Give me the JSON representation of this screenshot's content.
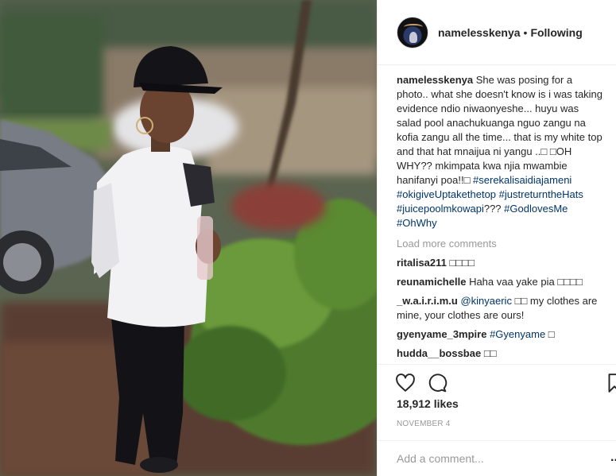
{
  "post": {
    "photo_alt": "Photo by namelesskenya"
  },
  "header": {
    "username": "namelesskenya",
    "separator": "•",
    "follow_status": "Following"
  },
  "caption": {
    "username": "namelesskenya",
    "text": "She was posing for a photo.. what she doesn't know is i was taking evidence ndio niwaonyeshe... huyu was salad pool anachukuanga nguo zangu na kofia zangu all the time... that is my white top and that hat mnaijua ni yangu ..□ □OH WHY?? mkimpata kwa njia mwambie hanifanyi poa!!□ ",
    "hashtags": [
      "#serekalisaidiajameni",
      "#okigiveUptakethetop",
      "#justreturntheHats",
      "#juicepoolmkowapi"
    ],
    "question_marks": "???",
    "hashtags_2": [
      "#GodlovesMe",
      "#OhWhy"
    ]
  },
  "load_more": "Load more comments",
  "comments": [
    {
      "username": "ritalisa211",
      "text": "□□□□"
    },
    {
      "username": "reunamichelle",
      "text": "Haha vaa yake pia □□□□"
    },
    {
      "username": "_w.a.i.r.i.m.u",
      "mention": "@kinyaeric",
      "text": " □□ my clothes are mine, your clothes are ours!"
    },
    {
      "username": "gyenyame_3mpire",
      "mention": "#Gyenyame",
      "text": " □"
    },
    {
      "username": "hudda__bossbae",
      "text": "□□"
    }
  ],
  "actions": {
    "like_icon": "heart-icon",
    "comment_icon": "comment-bubble-icon",
    "save_icon": "bookmark-icon"
  },
  "likes": "18,912 likes",
  "date": "NOVEMBER 4",
  "add_comment": {
    "placeholder": "Add a comment...",
    "more": "..."
  },
  "colors": {
    "link": "#003569",
    "muted": "#999999",
    "text": "#262626",
    "border": "#efefef"
  }
}
